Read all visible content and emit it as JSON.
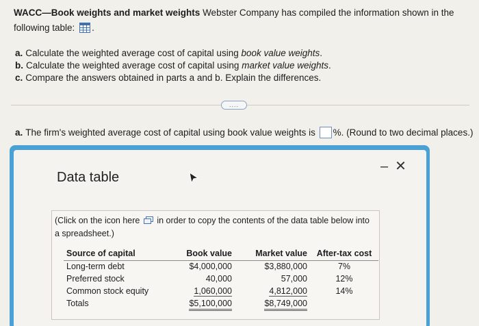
{
  "question": {
    "title": "WACC—Book weights and market weights",
    "intro": "Webster Company has compiled the information shown in the following table:",
    "period_after_icon": "."
  },
  "parts": [
    {
      "label": "a.",
      "text_pre": "Calculate the weighted average cost of capital using ",
      "text_em": "book value weights",
      "text_post": "."
    },
    {
      "label": "b.",
      "text_pre": "Calculate the weighted average cost of capital using ",
      "text_em": "market value weights",
      "text_post": "."
    },
    {
      "label": "c.",
      "text": "Compare the answers obtained in parts a and b. Explain the differences."
    }
  ],
  "more_button": "....",
  "answer": {
    "label": "a.",
    "text_pre": "The firm's weighted average cost of capital using book value weights is",
    "text_post": "%. (Round to two decimal places.)",
    "value": ""
  },
  "modal": {
    "title": "Data table",
    "minimize": "–",
    "close": "✕",
    "copy_note_pre": "(Click on the icon here",
    "copy_note_post": "in order to copy the contents of the data table below into a spreadsheet.)",
    "table": {
      "headers": [
        "Source of capital",
        "Book value",
        "Market value",
        "After-tax cost"
      ],
      "rows": [
        [
          "Long-term debt",
          "$4,000,000",
          "$3,880,000",
          "7%"
        ],
        [
          "Preferred stock",
          "40,000",
          "57,000",
          "12%"
        ],
        [
          "Common stock equity",
          "1,060,000",
          "4,812,000",
          "14%"
        ],
        [
          "Totals",
          "$5,100,000",
          "$8,749,000",
          ""
        ]
      ]
    }
  }
}
